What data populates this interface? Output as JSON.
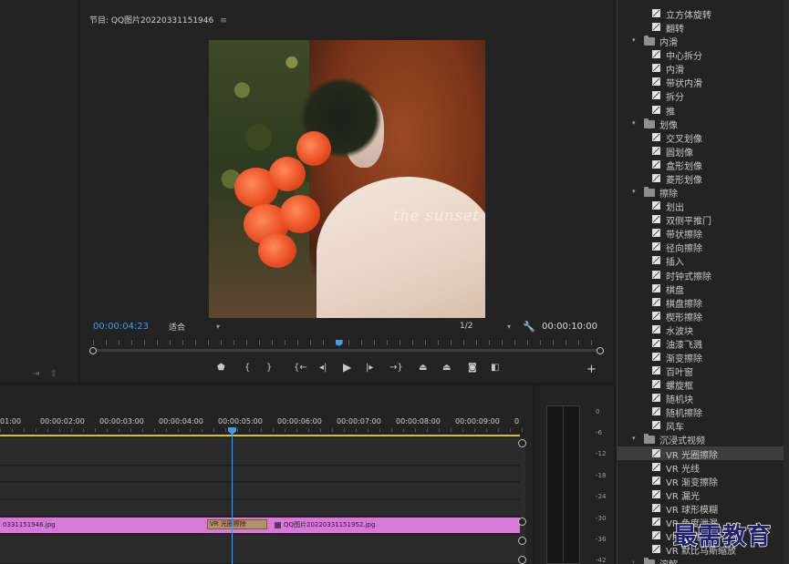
{
  "program_monitor": {
    "title": "节目: QQ图片20220331151946",
    "menu_icon": "hamburger-menu-icon",
    "overlay_text": "the sunset",
    "current_time": "00:00:04:23",
    "fit_option": "适合",
    "resolution_option": "1/2",
    "duration": "00:00:10:00",
    "playhead_position": 0.485
  },
  "timeline": {
    "ruler_labels": [
      "01:00",
      "00:00:02:00",
      "00:00:03:00",
      "00:00:04:00",
      "00:00:05:00",
      "00:00:06:00",
      "00:00:07:00",
      "00:00:08:00",
      "00:00:09:00",
      "0"
    ],
    "clip_left_label": "0331151946.jpg",
    "clip_right_label": "QQ图片20220331151952.jpg",
    "transition_label": "VR 光圈擦除",
    "clip_color": "#d779d6",
    "playhead_color": "#3d9de8",
    "work_area_color": "#d6c700"
  },
  "audio_meter": {
    "db_labels": [
      "0",
      "-6",
      "-12",
      "-18",
      "-24",
      "-30",
      "-36",
      "-42"
    ]
  },
  "effects_panel": {
    "rows": [
      {
        "type": "item",
        "label": "立方体旋转"
      },
      {
        "type": "item",
        "label": "翻转"
      },
      {
        "type": "folder",
        "label": "内滑"
      },
      {
        "type": "item",
        "label": "中心拆分"
      },
      {
        "type": "item",
        "label": "内滑"
      },
      {
        "type": "item",
        "label": "带状内滑"
      },
      {
        "type": "item",
        "label": "拆分"
      },
      {
        "type": "item",
        "label": "推"
      },
      {
        "type": "folder",
        "label": "划像"
      },
      {
        "type": "item",
        "label": "交叉划像"
      },
      {
        "type": "item",
        "label": "圆划像"
      },
      {
        "type": "item",
        "label": "盒形划像"
      },
      {
        "type": "item",
        "label": "菱形划像"
      },
      {
        "type": "folder",
        "label": "擦除"
      },
      {
        "type": "item",
        "label": "划出"
      },
      {
        "type": "item",
        "label": "双侧平推门"
      },
      {
        "type": "item",
        "label": "带状擦除"
      },
      {
        "type": "item",
        "label": "径向擦除"
      },
      {
        "type": "item",
        "label": "插入"
      },
      {
        "type": "item",
        "label": "时钟式擦除"
      },
      {
        "type": "item",
        "label": "棋盘"
      },
      {
        "type": "item",
        "label": "棋盘擦除"
      },
      {
        "type": "item",
        "label": "楔形擦除"
      },
      {
        "type": "item",
        "label": "水波块"
      },
      {
        "type": "item",
        "label": "油漆飞溅"
      },
      {
        "type": "item",
        "label": "渐变擦除"
      },
      {
        "type": "item",
        "label": "百叶窗"
      },
      {
        "type": "item",
        "label": "螺旋框"
      },
      {
        "type": "item",
        "label": "随机块"
      },
      {
        "type": "item",
        "label": "随机擦除"
      },
      {
        "type": "item",
        "label": "风车"
      },
      {
        "type": "folder",
        "label": "沉浸式视频"
      },
      {
        "type": "item",
        "label": "VR 光圈擦除",
        "selected": true
      },
      {
        "type": "item",
        "label": "VR 光线"
      },
      {
        "type": "item",
        "label": "VR 渐变擦除"
      },
      {
        "type": "item",
        "label": "VR 漏光"
      },
      {
        "type": "item",
        "label": "VR 球形模糊"
      },
      {
        "type": "item",
        "label": "VR 色度泄漏"
      },
      {
        "type": "item",
        "label": "VR 随机块"
      },
      {
        "type": "item",
        "label": "VR 默比乌斯缩放"
      },
      {
        "type": "folder-collapsed",
        "label": "溶解"
      }
    ],
    "selection_color": "#3d3d3d"
  },
  "watermark": {
    "text": "最需教育"
  }
}
